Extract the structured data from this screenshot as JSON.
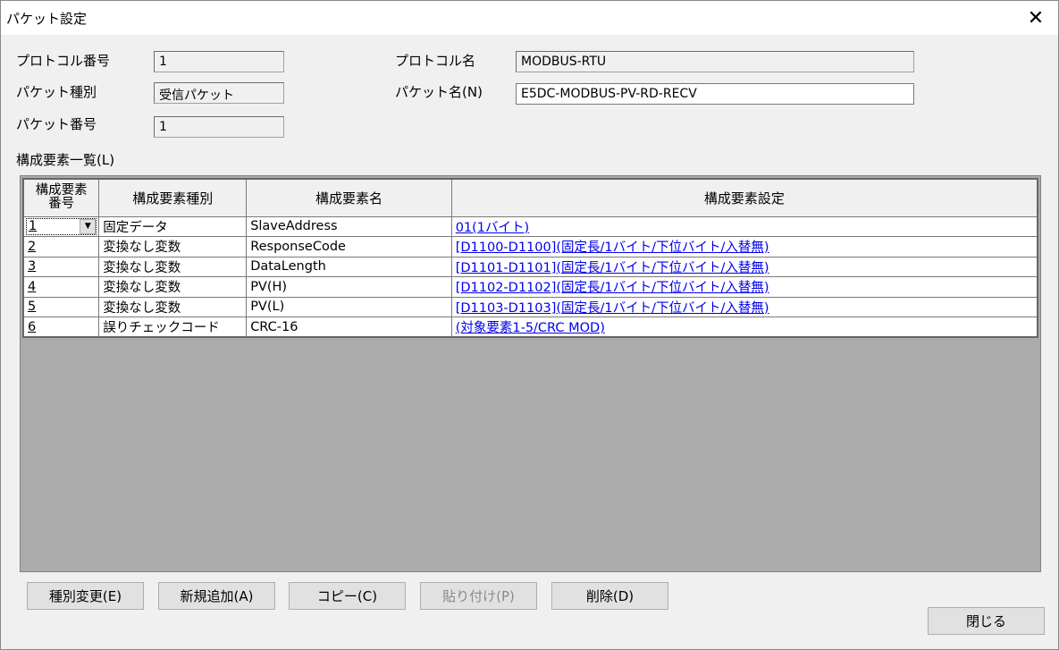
{
  "window": {
    "title": "パケット設定"
  },
  "header": {
    "protocol_number_label": "プロトコル番号",
    "protocol_number": "1",
    "protocol_name_label": "プロトコル名",
    "protocol_name": "MODBUS-RTU",
    "packet_type_label": "パケット種別",
    "packet_type": "受信パケット",
    "packet_name_label": "パケット名(N)",
    "packet_name": "E5DC-MODBUS-PV-RD-RECV",
    "packet_number_label": "パケット番号",
    "packet_number": "1"
  },
  "element_list": {
    "label": "構成要素一覧(L)",
    "columns": [
      "構成要素\n番号",
      "構成要素種別",
      "構成要素名",
      "構成要素設定"
    ],
    "rows": [
      {
        "no": "1",
        "type": "固定データ",
        "name": "SlaveAddress",
        "setting": "01(1バイト)"
      },
      {
        "no": "2",
        "type": "変換なし変数",
        "name": "ResponseCode",
        "setting": "[D1100-D1100](固定長/1バイト/下位バイト/入替無)"
      },
      {
        "no": "3",
        "type": "変換なし変数",
        "name": "DataLength",
        "setting": "[D1101-D1101](固定長/1バイト/下位バイト/入替無)"
      },
      {
        "no": "4",
        "type": "変換なし変数",
        "name": "PV(H)",
        "setting": "[D1102-D1102](固定長/1バイト/下位バイト/入替無)"
      },
      {
        "no": "5",
        "type": "変換なし変数",
        "name": "PV(L)",
        "setting": "[D1103-D1103](固定長/1バイト/下位バイト/入替無)"
      },
      {
        "no": "6",
        "type": "誤りチェックコード",
        "name": "CRC-16",
        "setting": "(対象要素1-5/CRC MOD)"
      }
    ]
  },
  "buttons": {
    "change_type": "種別変更(E)",
    "add_new": "新規追加(A)",
    "copy": "コピー(C)",
    "paste": "貼り付け(P)",
    "delete": "削除(D)",
    "close": "閉じる"
  },
  "icons": {
    "close": "close-icon",
    "dropdown": "chevron-down-icon"
  }
}
